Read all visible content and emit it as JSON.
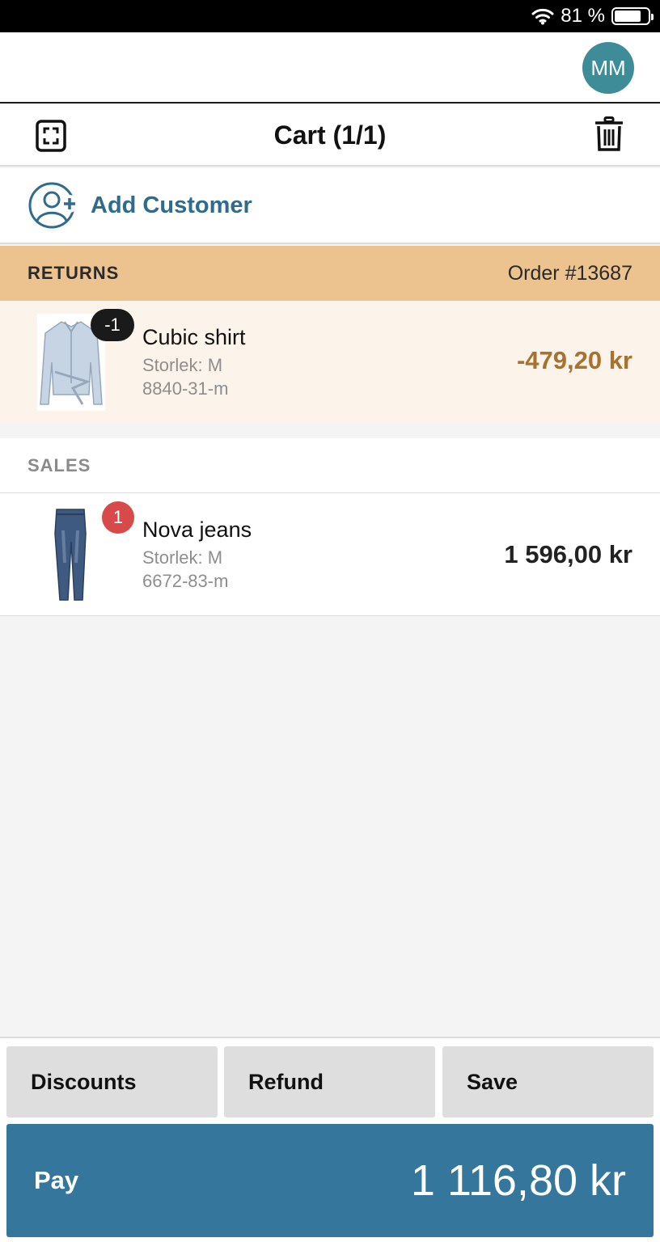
{
  "status_bar": {
    "battery_text": "81 %",
    "battery_level": 0.81
  },
  "user": {
    "initials": "MM"
  },
  "cart": {
    "title": "Cart (1/1)"
  },
  "add_customer": {
    "label": "Add Customer"
  },
  "returns": {
    "title": "RETURNS",
    "order": "Order #13687",
    "item": {
      "qty": "-1",
      "name": "Cubic shirt",
      "size": "Storlek: M",
      "sku": "8840-31-m",
      "price": "-479,20 kr"
    }
  },
  "sales": {
    "title": "SALES",
    "item": {
      "qty": "1",
      "name": "Nova jeans",
      "size": "Storlek: M",
      "sku": "6672-83-m",
      "price": "1 596,00 kr"
    }
  },
  "actions": {
    "discounts": "Discounts",
    "refund": "Refund",
    "save": "Save"
  },
  "pay": {
    "label": "Pay",
    "total": "1 116,80 kr"
  },
  "colors": {
    "accent": "#35769c",
    "returns_bg": "#ecc38f",
    "return_price": "#a8722e",
    "badge_red": "#d84a4a",
    "avatar": "#3d8c98"
  }
}
